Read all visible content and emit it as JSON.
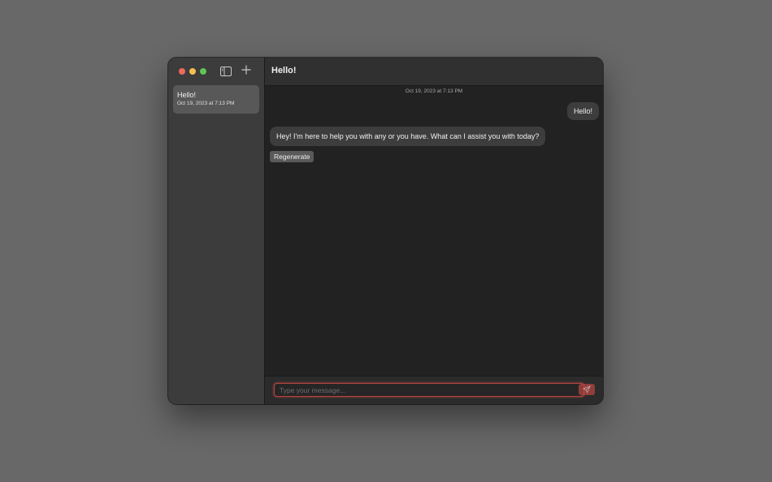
{
  "window": {
    "title": "Hello!"
  },
  "sidebar": {
    "items": [
      {
        "title": "Hello!",
        "date": "Oct 19, 2023 at 7:13 PM"
      }
    ]
  },
  "chat": {
    "timestamp": "Oct 19, 2023 at 7:13 PM",
    "messages": [
      {
        "role": "user",
        "text": "Hello!"
      },
      {
        "role": "assistant",
        "text": "Hey! I'm here to help you with any or you have. What can I assist you with today?"
      }
    ],
    "regenerate_label": "Regenerate"
  },
  "composer": {
    "placeholder": "Type your message...",
    "value": ""
  },
  "icons": {
    "sidebar_toggle": "sidebar-toggle-icon",
    "new_chat": "plus-icon",
    "send": "paper-plane-icon"
  },
  "colors": {
    "accent": "#b4453f",
    "close": "#ec6a5e",
    "minimize": "#f4bf4f",
    "zoom": "#61c554"
  }
}
